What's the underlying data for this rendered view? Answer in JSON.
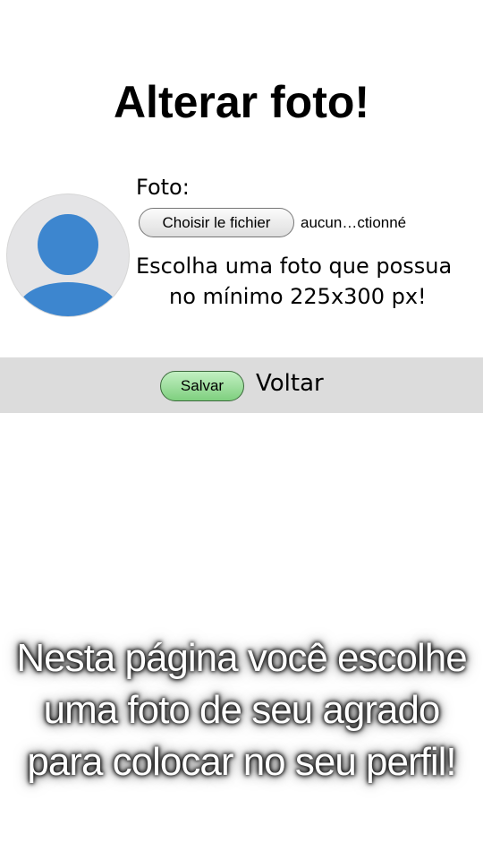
{
  "page": {
    "title": "Alterar foto!",
    "foto_label": "Foto:",
    "file_button_label": "Choisir le fichier",
    "file_status": "aucun…ctionné",
    "hint_line1": "Escolha uma foto que possua",
    "hint_line2": "no mínimo 225x300 px!",
    "save_label": "Salvar",
    "back_label": "Voltar"
  },
  "caption": {
    "line1": "Nesta página você escolhe",
    "line2": "uma foto de seu agrado",
    "line3": "para colocar no seu perfil!"
  },
  "icons": {
    "avatar": "default-user-avatar-icon"
  },
  "colors": {
    "avatar_blue": "#3d86cf",
    "avatar_bg": "#e4e4e6",
    "save_button_green": "#8fd68f",
    "footer_bar": "#dcdcdc"
  }
}
